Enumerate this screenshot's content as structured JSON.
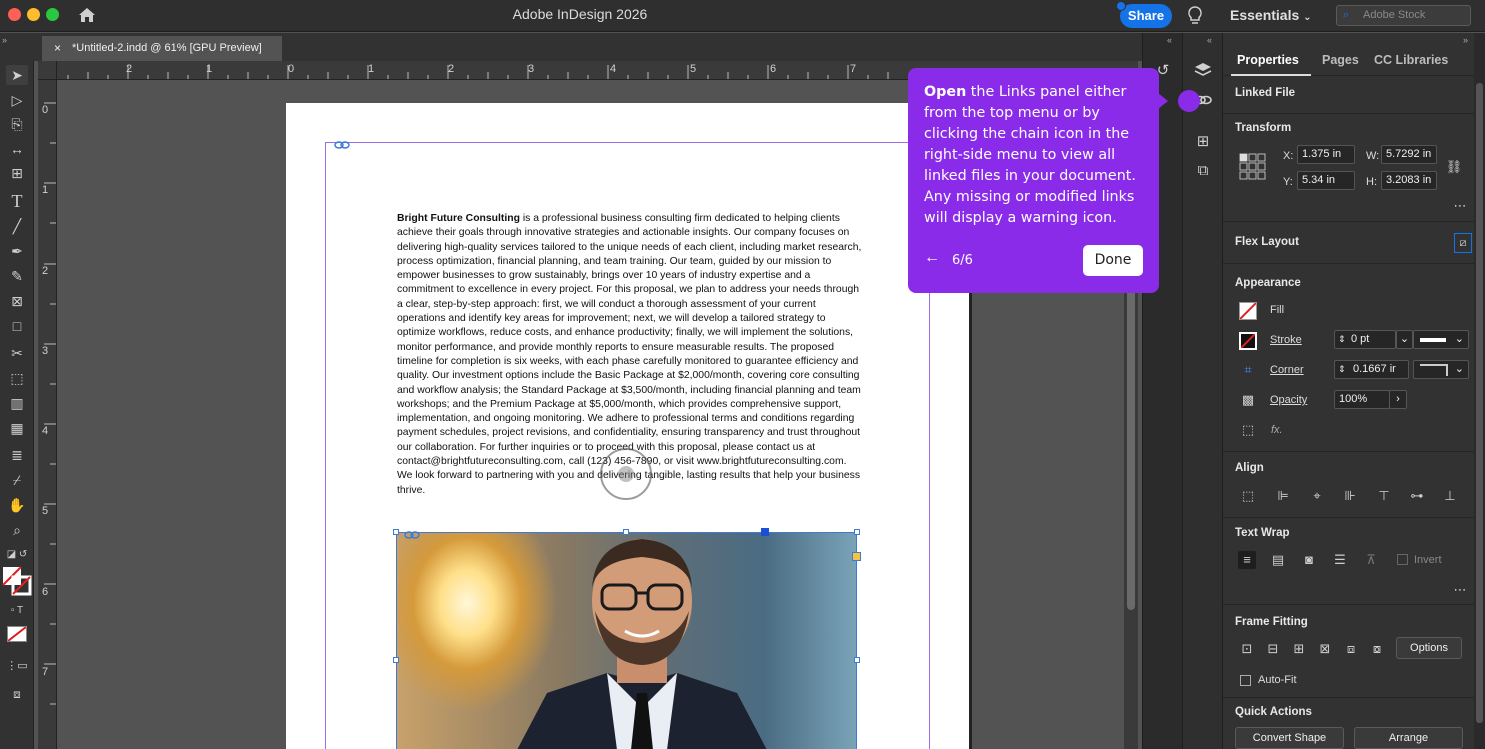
{
  "app": {
    "title": "Adobe InDesign 2026",
    "share_label": "Share",
    "workspace": "Essentials",
    "stock_placeholder": "Adobe Stock"
  },
  "document": {
    "tab_title": "*Untitled-2.indd @ 61% [GPU Preview]"
  },
  "ruler": {
    "h_ticks": [
      "2",
      "1",
      "0",
      "1",
      "2",
      "3",
      "4",
      "5",
      "6",
      "7"
    ],
    "v_ticks": [
      "0",
      "1",
      "2",
      "3",
      "4",
      "5",
      "6",
      "7"
    ]
  },
  "body": {
    "company": "Bright Future Consulting",
    "text": " is a professional business consulting firm dedicated to helping clients achieve their goals through innovative strategies and actionable insights. Our company focuses on delivering high-quality services tailored to the unique needs of each client, including market research, process optimization, financial planning, and team training. Our team, guided by our mission to empower businesses to grow sustainably, brings over 10 years of industry expertise and a commitment to excellence in every project. For this proposal, we plan to address your needs through a clear, step-by-step approach: first, we will conduct a thorough assessment of your current operations and identify key areas for improvement; next, we will develop a tailored strategy to optimize workflows, reduce costs, and enhance productivity; finally, we will implement the solutions, monitor performance, and provide monthly reports to ensure measurable results. The proposed timeline for completion is six weeks, with each phase carefully monitored to guarantee efficiency and quality. Our investment options include the Basic Package at $2,000/month, covering core consulting and workflow analysis; the Standard Package at $3,500/month, including financial planning and team workshops; and the Premium Package at $5,000/month, which provides comprehensive support, implementation, and ongoing monitoring. We adhere to professional terms and conditions regarding payment schedules, project revisions, and confidentiality, ensuring transparency and trust throughout our collaboration. For further inquiries or to proceed with this proposal, please contact us at contact@brightfutureconsulting.com, call (123) 456-7890, or visit www.brightfutureconsulting.com. We look forward to partnering with you and delivering tangible, lasting results that help your business thrive."
  },
  "tour": {
    "bold": "Open",
    "text": " the Links panel either from the top menu or by clicking the chain icon in the right-side menu to view all linked files in your document. Any missing or modified links will display a warning icon.",
    "count": "6/6",
    "done_label": "Done"
  },
  "properties": {
    "tabs": [
      "Properties",
      "Pages",
      "CC Libraries"
    ],
    "linked_file": "Linked File",
    "transform": {
      "title": "Transform",
      "x_label": "X:",
      "x": "1.375 in",
      "y_label": "Y:",
      "y": "5.34 in",
      "w_label": "W:",
      "w": "5.7292 in",
      "h_label": "H:",
      "h": "3.2083 in"
    },
    "flex_layout": "Flex Layout",
    "appearance": {
      "title": "Appearance",
      "fill": "Fill",
      "stroke": "Stroke",
      "stroke_weight": "0 pt",
      "corner": "Corner",
      "corner_value": "0.1667 ir",
      "opacity": "Opacity",
      "opacity_value": "100%",
      "fx": "fx."
    },
    "align": "Align",
    "text_wrap": {
      "title": "Text Wrap",
      "invert": "Invert"
    },
    "frame_fitting": {
      "title": "Frame Fitting",
      "options": "Options",
      "auto_fit": "Auto-Fit"
    },
    "quick_actions": {
      "title": "Quick Actions",
      "convert_shape": "Convert Shape",
      "arrange": "Arrange"
    }
  },
  "colors": {
    "accent": "#8a2bea",
    "share": "#1473e6",
    "frame": "#3d7bd6"
  }
}
